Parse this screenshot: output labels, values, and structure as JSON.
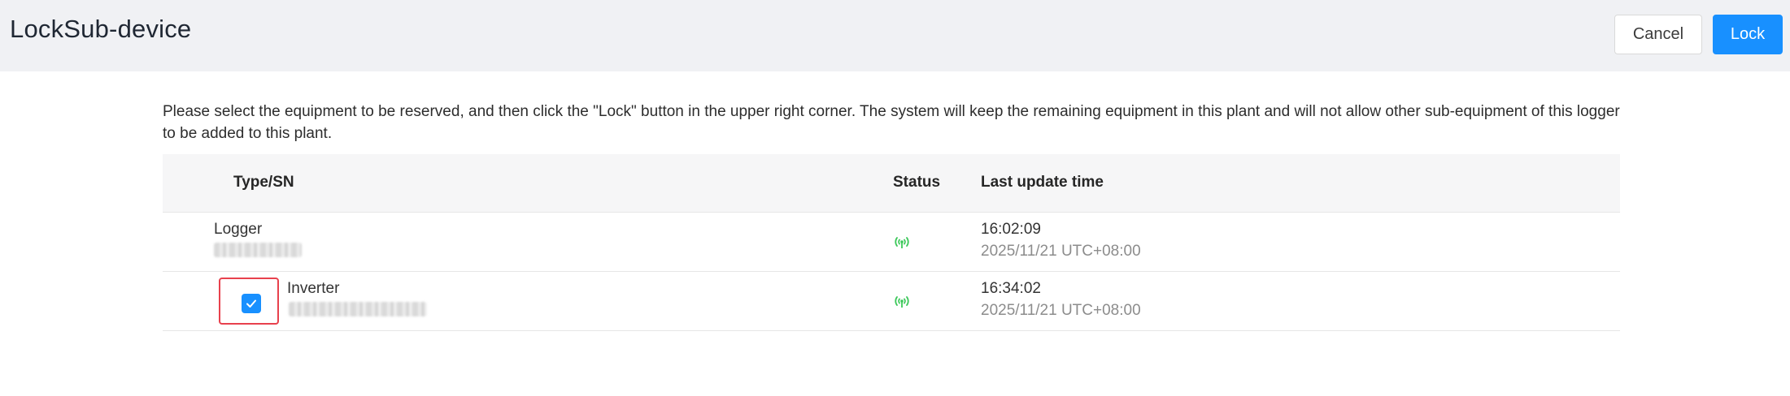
{
  "header": {
    "title": "LockSub-device",
    "cancel_label": "Cancel",
    "lock_label": "Lock"
  },
  "instruction": "Please select the equipment to be reserved, and then click the \"Lock\" button in the upper right corner. The system will keep the remaining equipment in this plant and will not allow other sub-equipment of this logger to be added to this plant.",
  "table": {
    "columns": [
      "Type/SN",
      "Status",
      "Last update time"
    ],
    "rows": [
      {
        "type": "Logger",
        "status": "online",
        "time": "16:02:09",
        "date": "2025/11/21 UTC+08:00",
        "selected": false
      },
      {
        "type": "Inverter",
        "status": "online",
        "time": "16:34:02",
        "date": "2025/11/21 UTC+08:00",
        "selected": true
      }
    ]
  },
  "colors": {
    "accent": "#1890ff",
    "online": "#3cc85a",
    "highlight": "#e8414d"
  },
  "icons": {
    "status": "signal-online-icon",
    "checkbox": "checkmark-icon"
  }
}
